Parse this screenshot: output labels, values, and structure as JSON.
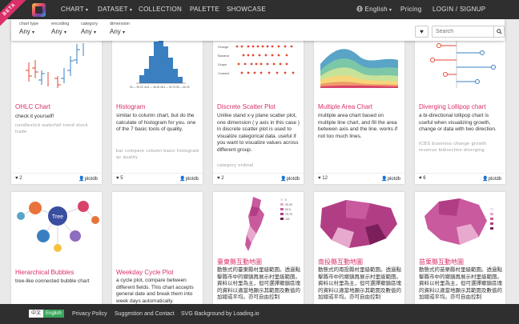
{
  "nav": {
    "beta": "BETA",
    "items": [
      {
        "label": "CHART",
        "caret": "▾"
      },
      {
        "label": "DATASET",
        "caret": "▾"
      },
      {
        "label": "COLLECTION",
        "caret": ""
      },
      {
        "label": "PALETTE",
        "caret": ""
      },
      {
        "label": "SHOWCASE",
        "caret": ""
      }
    ],
    "language": "English",
    "pricing": "Pricing",
    "login": "LOGIN / SIGNUP"
  },
  "filters": [
    {
      "label": "chart type",
      "value": "Any"
    },
    {
      "label": "encoding",
      "value": "Any"
    },
    {
      "label": "category",
      "value": "Any"
    },
    {
      "label": "dimension",
      "value": "Any"
    }
  ],
  "search": {
    "placeholder": "Search"
  },
  "cards": [
    {
      "title": "OHLC Chart",
      "desc": "check it yourself!",
      "tags": "candlestick  waterfall  trend  stock  trade",
      "favs": "2",
      "author": "plotdb"
    },
    {
      "title": "Histogram",
      "desc": "similar to column chart, but do the calculate of histogram for you. one of the 7 basic tools of quality.",
      "tags": "bar  compare  column  basic  histogram  qc  quality",
      "favs": "5",
      "author": "plotdb"
    },
    {
      "title": "Discrete Scatter Plot",
      "desc": "Unlike stand x-y plane scatter plot, one dimension ( y axis in this case ) in discrete scatter plot is used to visualize categorical data. useful if you want to visualize values across different group.",
      "tags": "category  ordinal",
      "favs": "2",
      "author": "plotdb"
    },
    {
      "title": "Multiple Area Chart",
      "desc": "multiple area chart based on multiple line chart, and fill the area between axis and the line. works if not too much lines.",
      "tags": "",
      "favs": "12",
      "author": "plotdb"
    },
    {
      "title": "Diverging Lollipop chart",
      "desc": "a bi-directional lollipop chart is useful when visualizing growth, change or data with two direction.",
      "tags": "ICBS  business  change  growth  revenue  bidirection  diverging",
      "favs": "6",
      "author": "plotdb"
    },
    {
      "title": "Hierarchical Bubbles",
      "desc": "tree-like connected bubble chart",
      "tags": "",
      "favs": "",
      "author": ""
    },
    {
      "title": "Weekday Cycle Plot",
      "desc": "a cycle plot, compare between different fields. This chart accepts general date and break them into week days automatically.",
      "tags": "",
      "favs": "",
      "author": ""
    },
    {
      "title": "臺東縣互動地圖",
      "desc": "動態式的臺東縣村里級範圍。透過點擊縣市中的鄉鎮再展示村里級範圍。資料以村里為主，但可選擇鄉鎮區塊的資料以適當地顯示其範圍及數值的加總或平均。亦可自由控制",
      "tags": "",
      "favs": "",
      "author": ""
    },
    {
      "title": "南投縣互動地圖",
      "desc": "動態式的南投縣村里級範圍。透過點擊縣市中的鄉鎮再展示村里級範圍。資料以村里為主，但可選擇鄉鎮區塊的資料以適當地顯示其範圍及數值的加總或平均。亦可自由控制",
      "tags": "",
      "favs": "",
      "author": ""
    },
    {
      "title": "苗栗縣互動地圖",
      "desc": "動態式的苗栗縣村里級範圍。透過點擊縣市中的鄉鎮再展示村里級範圍。資料以村里為主，但可選擇鄉鎮區塊的資料以適當地顯示其範圍及數值的加總或平均。亦可自由控制",
      "tags": "",
      "favs": "",
      "author": ""
    }
  ],
  "thumbs": {
    "histogram_ticks": [
      "30 — 35.25",
      "44.8 — 46.25",
      "48.4 — 50.75",
      "55 — 60.25"
    ],
    "scatter_labels": [
      "Apple",
      "Orange",
      "Banana",
      "Grape",
      "Custard"
    ],
    "tree_label": "Tree",
    "map_legend": [
      "0",
      "25.25",
      "50.5",
      "75.75",
      "101"
    ]
  },
  "footer": {
    "lang_zh": "中文",
    "lang_en": "English",
    "links": [
      "Privacy Policy",
      "Suggestion and Contact",
      "SVG Background by Loading.io"
    ]
  },
  "icons": {
    "heart": "heart-icon",
    "search": "search-icon",
    "user": "user-icon",
    "globe": "globe-icon"
  }
}
